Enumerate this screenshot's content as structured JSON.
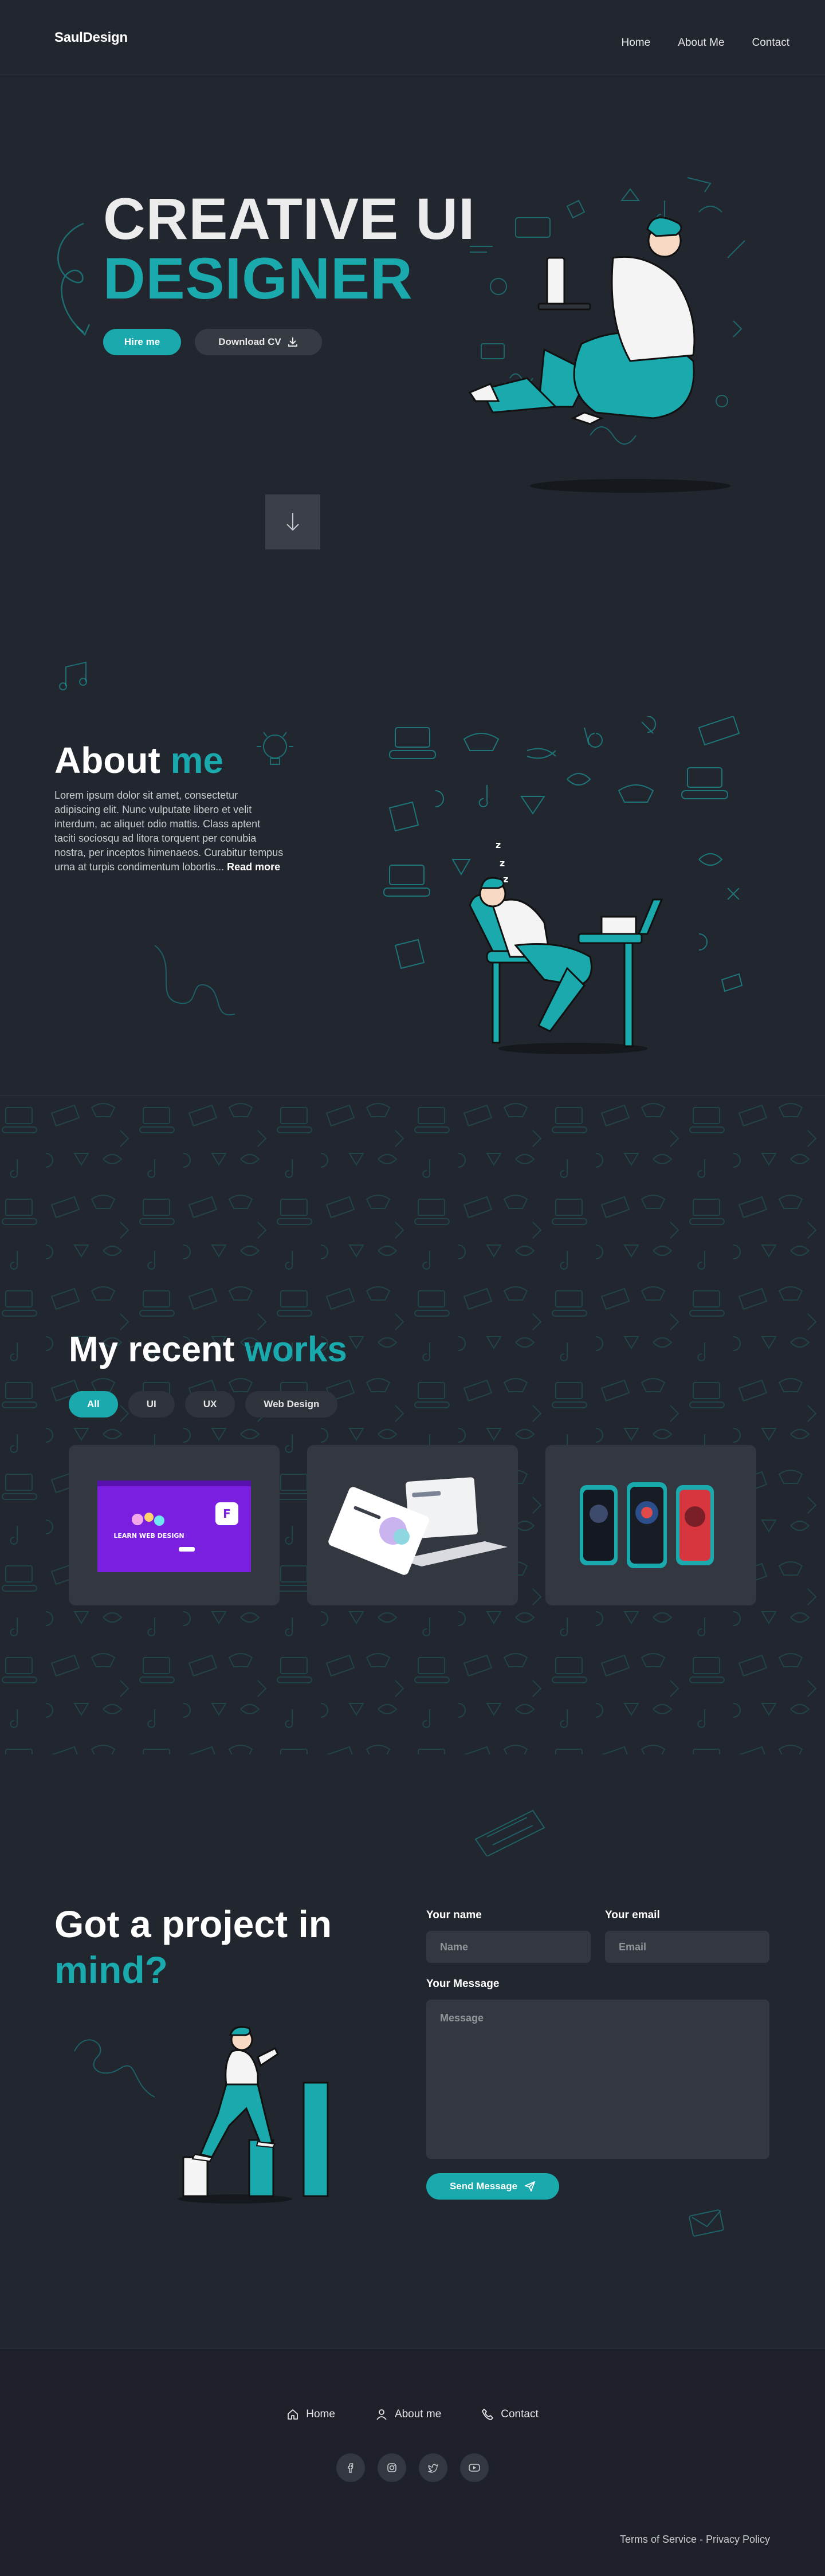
{
  "header": {
    "logo": "SaulDesign",
    "nav": [
      "Home",
      "About Me",
      "Contact"
    ]
  },
  "hero": {
    "title_line1": "CREATIVE UI",
    "title_line2": "DESIGNER",
    "hire_label": "Hire me",
    "cv_label": "Download CV",
    "scroll_icon": "arrow-down-icon"
  },
  "about": {
    "title_a": "About",
    "title_b": "me",
    "body": "Lorem ipsum dolor sit amet, consectetur adipiscing elit. Nunc vulputate libero et velit interdum, ac aliquet odio mattis. Class aptent taciti sociosqu ad litora torquent per conubia nostra, per inceptos himenaeos. Curabitur tempus urna at turpis condimentum lobortis...",
    "read_more": "Read more"
  },
  "works": {
    "title_a": "My recent",
    "title_b": "works",
    "filters": [
      "All",
      "UI",
      "UX",
      "Web Design"
    ],
    "active_filter": "All",
    "card1_heading": "LEARN WEB DESIGN"
  },
  "contact": {
    "title_line1": "Got a project in",
    "title_line2": "mind?",
    "name_label": "Your name",
    "name_placeholder": "Name",
    "email_label": "Your email",
    "email_placeholder": "Email",
    "message_label": "Your Message",
    "message_placeholder": "Message",
    "send_label": "Send Message"
  },
  "footer": {
    "nav": [
      "Home",
      "About me",
      "Contact"
    ],
    "socials": [
      "facebook-icon",
      "instagram-icon",
      "twitter-icon",
      "youtube-icon"
    ],
    "legal": "Terms of Service - Privacy Policy"
  },
  "colors": {
    "accent": "#1aa9ac",
    "background": "#22262e",
    "surface": "#33373f"
  }
}
